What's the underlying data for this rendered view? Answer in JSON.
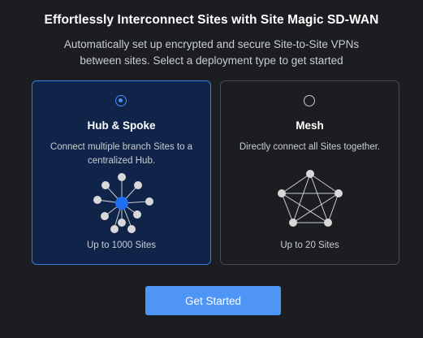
{
  "header": {
    "title": "Effortlessly Interconnect Sites with Site Magic SD-WAN",
    "subtitle": "Automatically set up encrypted and secure Site-to-Site VPNs between sites. Select a deployment type to get started"
  },
  "options": [
    {
      "id": "hub-spoke",
      "title": "Hub & Spoke",
      "description": "Connect multiple branch Sites to a centralized Hub.",
      "limit": "Up to 1000 Sites",
      "selected": true,
      "icon": "hub-spoke-topology-icon"
    },
    {
      "id": "mesh",
      "title": "Mesh",
      "description": "Directly connect all Sites together.",
      "limit": "Up to 20 Sites",
      "selected": false,
      "icon": "mesh-topology-icon"
    }
  ],
  "cta": {
    "label": "Get Started"
  },
  "colors": {
    "background": "#1c1d21",
    "accent": "#4f95f6",
    "selected_card_bg": "#0f2448",
    "selected_card_border": "#3b7ddb",
    "hub_node": "#1f6ff2",
    "spoke_node": "#d8d8d8"
  }
}
